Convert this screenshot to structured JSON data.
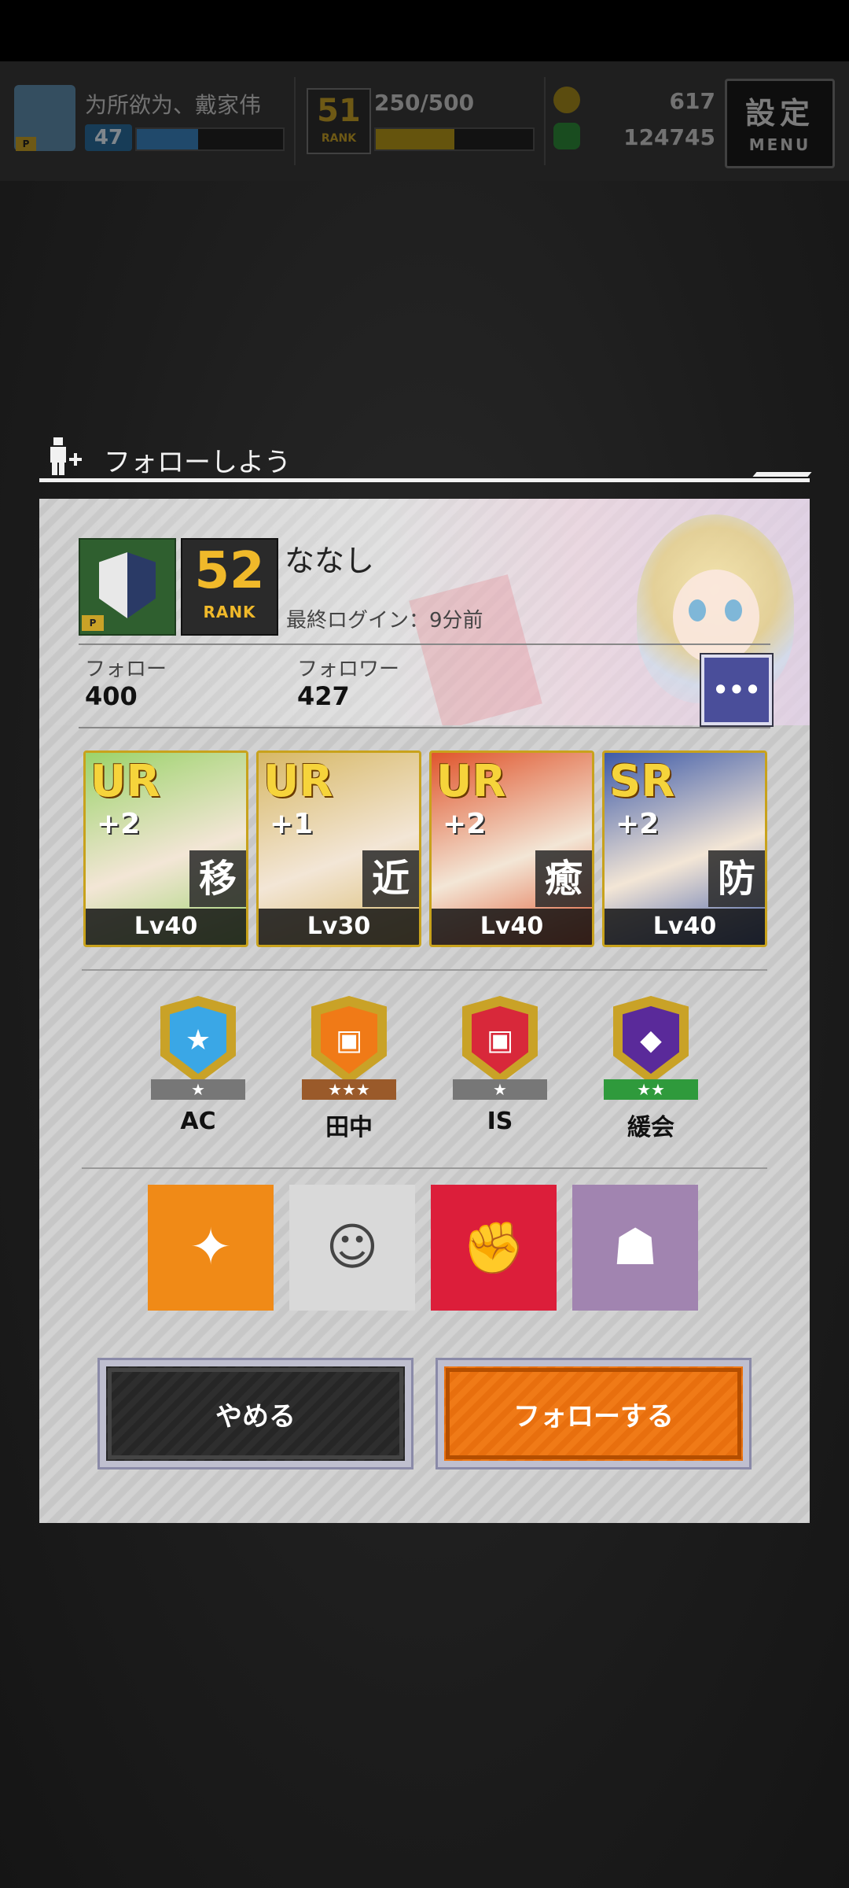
{
  "header": {
    "player_name": "为所欲为、戴家伟",
    "player_level": "47",
    "exp_fill": 0.42,
    "rank_number": "51",
    "rank_label": "RANK",
    "stamina": "250/500",
    "stamina_fill": 0.5,
    "coins": "617",
    "gems": "124745",
    "menu_kanji": "設定",
    "menu_label": "MENU"
  },
  "dialog": {
    "title": "フォローしよう",
    "profile": {
      "name": "ななし",
      "rank_number": "52",
      "rank_label": "RANK",
      "last_login": "最終ログイン：9分前",
      "follow_label": "フォロー",
      "follow_count": "400",
      "follower_label": "フォロワー",
      "follower_count": "427",
      "more_label": "•••"
    },
    "cards": [
      {
        "rarity": "UR",
        "plus": "+2",
        "type": "移",
        "level": "Lv40",
        "color": "#9bd36a"
      },
      {
        "rarity": "UR",
        "plus": "+1",
        "type": "近",
        "level": "Lv30",
        "color": "#d7b866"
      },
      {
        "rarity": "UR",
        "plus": "+2",
        "type": "癒",
        "level": "Lv40",
        "color": "#e0552c"
      },
      {
        "rarity": "SR",
        "plus": "+2",
        "type": "防",
        "level": "Lv40",
        "color": "#3d5aa8"
      }
    ],
    "badges": [
      {
        "label": "AC",
        "stars": "★",
        "ribbon_color": "#777777",
        "inner_color": "#3aa7e6",
        "glyph": "★"
      },
      {
        "label": "田中",
        "stars": "★★★",
        "ribbon_color": "#9a5a2a",
        "inner_color": "#f07a17",
        "glyph": "▣"
      },
      {
        "label": "IS",
        "stars": "★",
        "ribbon_color": "#777777",
        "inner_color": "#d8283a",
        "glyph": "▣"
      },
      {
        "label": "緩会",
        "stars": "★★",
        "ribbon_color": "#2f9a3c",
        "inner_color": "#5a2a9a",
        "glyph": "◆"
      }
    ],
    "skills": [
      {
        "name": "gun-icon",
        "bg": "#f08a17",
        "glyph": "✦"
      },
      {
        "name": "character-icon",
        "bg": "#d9d9d9",
        "glyph": "☺"
      },
      {
        "name": "fist-icon",
        "bg": "#dc1e3a",
        "glyph": "✊"
      },
      {
        "name": "fox-mask-icon",
        "bg": "#a184b0",
        "glyph": "☗"
      }
    ],
    "buttons": {
      "cancel": "やめる",
      "follow": "フォローする"
    }
  }
}
